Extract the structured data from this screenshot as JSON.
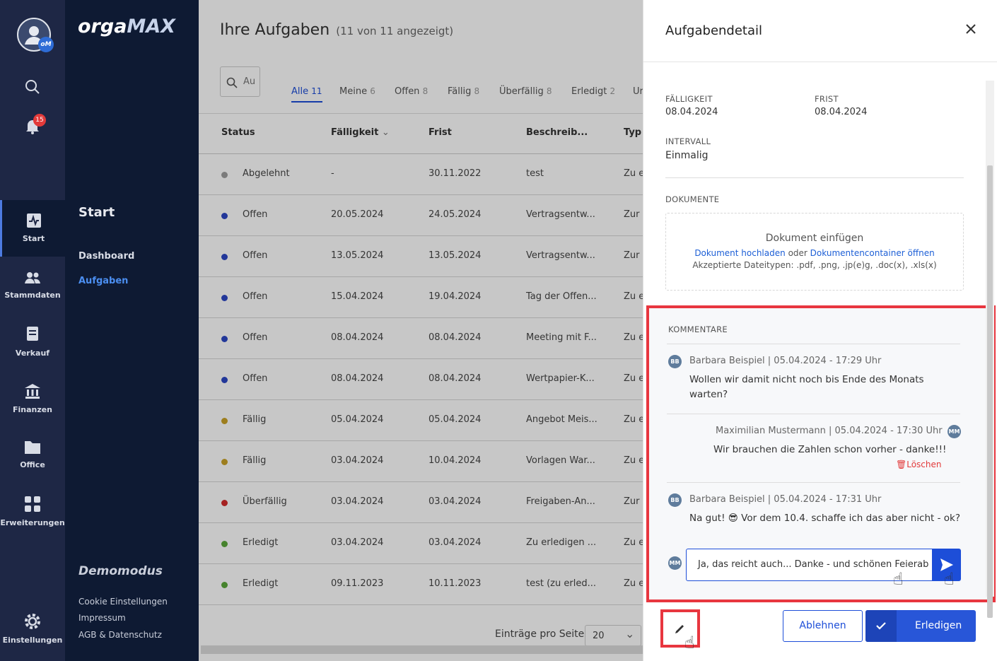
{
  "rail": {
    "avatar_initials": "oM",
    "notification_count": "15",
    "items": [
      {
        "label": "Start",
        "icon": "activity-icon"
      },
      {
        "label": "Stammdaten",
        "icon": "people-icon"
      },
      {
        "label": "Verkauf",
        "icon": "receipt-icon"
      },
      {
        "label": "Finanzen",
        "icon": "bank-icon"
      },
      {
        "label": "Office",
        "icon": "folder-icon"
      },
      {
        "label": "Erweiterungen",
        "icon": "grid-icon"
      }
    ],
    "settings_label": "Einstellungen"
  },
  "nav": {
    "logo_a": "orga",
    "logo_b": "MAX",
    "section_title": "Start",
    "items": [
      "Dashboard",
      "Aufgaben"
    ],
    "demo_label": "Demomodus",
    "footer_links": [
      "Cookie Einstellungen",
      "Impressum",
      "AGB & Datenschutz"
    ]
  },
  "main": {
    "title": "Ihre Aufgaben",
    "subtitle": "(11 von 11 angezeigt)",
    "search_placeholder": "Au",
    "tabs": [
      {
        "label": "Alle",
        "count": "11"
      },
      {
        "label": "Meine",
        "count": "6"
      },
      {
        "label": "Offen",
        "count": "8"
      },
      {
        "label": "Fällig",
        "count": "8"
      },
      {
        "label": "Überfällig",
        "count": "8"
      },
      {
        "label": "Erledigt",
        "count": "2"
      },
      {
        "label": "Ur",
        "count": ""
      }
    ],
    "columns": [
      "Status",
      "Fälligkeit",
      "Frist",
      "Beschreib...",
      "Typ"
    ],
    "rows": [
      {
        "status": "Abgelehnt",
        "color": "#9e9e9e",
        "faellig": "-",
        "frist": "30.11.2022",
        "desc": "test",
        "typ": "Zu e"
      },
      {
        "status": "Offen",
        "color": "#2c47c4",
        "faellig": "20.05.2024",
        "frist": "24.05.2024",
        "desc": "Vertragsentw...",
        "typ": "Zur"
      },
      {
        "status": "Offen",
        "color": "#2c47c4",
        "faellig": "13.05.2024",
        "frist": "13.05.2024",
        "desc": "Vertragsentw...",
        "typ": "Zur"
      },
      {
        "status": "Offen",
        "color": "#2c47c4",
        "faellig": "15.04.2024",
        "frist": "19.04.2024",
        "desc": "Tag der Offen...",
        "typ": "Zu e"
      },
      {
        "status": "Offen",
        "color": "#2c47c4",
        "faellig": "08.04.2024",
        "frist": "08.04.2024",
        "desc": "Meeting mit F...",
        "typ": "Zu e"
      },
      {
        "status": "Offen",
        "color": "#2c47c4",
        "faellig": "08.04.2024",
        "frist": "08.04.2024",
        "desc": "Wertpapier-K...",
        "typ": "Zu e"
      },
      {
        "status": "Fällig",
        "color": "#c9a227",
        "faellig": "05.04.2024",
        "frist": "05.04.2024",
        "desc": "Angebot Meis...",
        "typ": "Zu e"
      },
      {
        "status": "Fällig",
        "color": "#c9a227",
        "faellig": "03.04.2024",
        "frist": "10.04.2024",
        "desc": "Vorlagen War...",
        "typ": "Zu e"
      },
      {
        "status": "Überfällig",
        "color": "#d42b2b",
        "faellig": "03.04.2024",
        "frist": "03.04.2024",
        "desc": "Freigaben-An...",
        "typ": "Zur"
      },
      {
        "status": "Erledigt",
        "color": "#5aa83a",
        "faellig": "03.04.2024",
        "frist": "03.04.2024",
        "desc": "Zu erledigen ...",
        "typ": "Zu e"
      },
      {
        "status": "Erledigt",
        "color": "#5aa83a",
        "faellig": "09.11.2023",
        "frist": "10.11.2023",
        "desc": "test (zu erled...",
        "typ": "Zu e"
      }
    ],
    "page_size_label": "Einträge pro Seite",
    "page_size_value": "20"
  },
  "panel": {
    "title": "Aufgabendetail",
    "faelligkeit_label": "FÄLLIGKEIT",
    "faelligkeit_value": "08.04.2024",
    "frist_label": "FRIST",
    "frist_value": "08.04.2024",
    "intervall_label": "INTERVALL",
    "intervall_value": "Einmalig",
    "dokumente_label": "DOKUMENTE",
    "doc_title": "Dokument einfügen",
    "doc_upload": "Dokument hochladen",
    "doc_or": "oder",
    "doc_container": "Dokumentencontainer öffnen",
    "doc_types": "Akzeptierte Dateitypen: .pdf, .png, .jp(e)g, .doc(x), .xls(x)",
    "kommentare_label": "KOMMENTARE",
    "comments": [
      {
        "initials": "BB",
        "author": "Barbara Beispiel | 05.04.2024 - 17:29 Uhr",
        "line1": "Wollen wir damit nicht noch bis Ende des Monats",
        "line2": "warten?"
      },
      {
        "initials": "MM",
        "author": "Maximilian Mustermann | 05.04.2024 - 17:30 Uhr",
        "line1": "Wir brauchen die Zahlen schon vorher - danke!!!",
        "delete": "Löschen"
      },
      {
        "initials": "BB",
        "author": "Barbara Beispiel | 05.04.2024 - 17:31 Uhr",
        "line1": "Na gut! 😎 Vor dem 10.4. schaffe ich das aber nicht - ok?"
      }
    ],
    "input_initials": "MM",
    "input_value": "Ja, das reicht auch... Danke - und schönen Feierab",
    "reject_label": "Ablehnen",
    "done_label": "Erledigen",
    "highlight_color": "#e8363f",
    "accent_color": "#1d4ed8"
  }
}
